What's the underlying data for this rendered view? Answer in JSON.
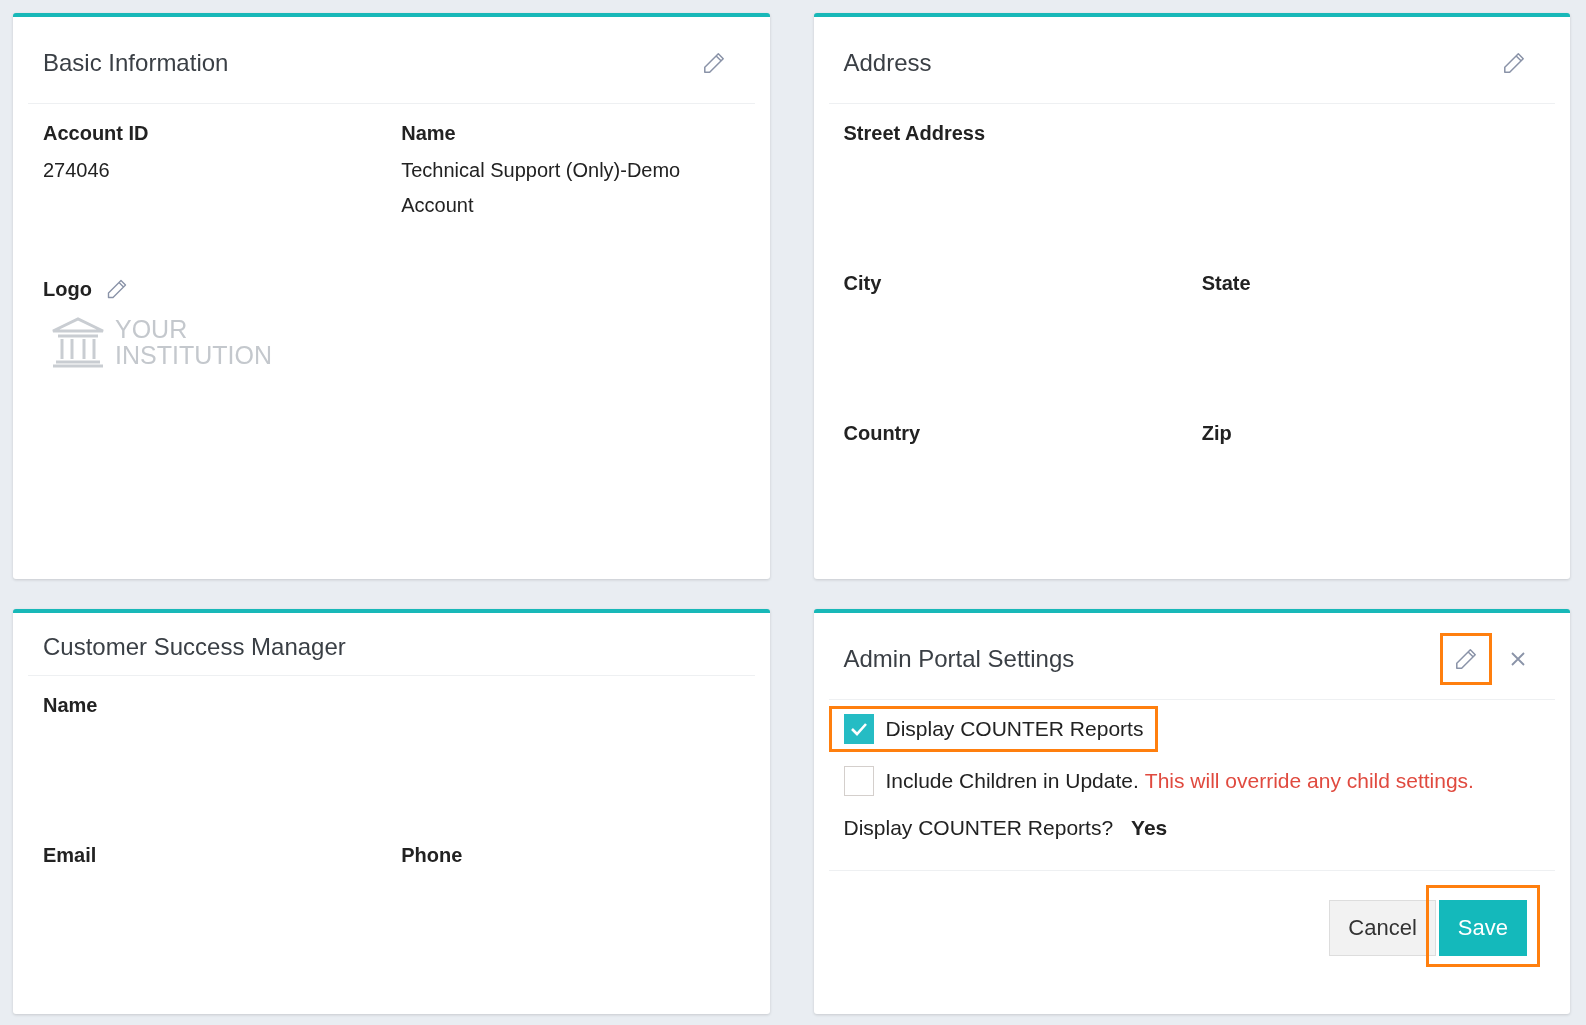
{
  "cards": [
    {
      "kind": "fields",
      "title": "Basic Information",
      "edit": {
        "highlighted": false
      },
      "fields": [
        {
          "kind": "text",
          "label": "Account ID",
          "value": "274046",
          "wide": false
        },
        {
          "kind": "text",
          "label": "Name",
          "value": "Technical Support (Only)-Demo Account",
          "wide": false
        },
        {
          "kind": "logo",
          "label": "Logo",
          "logo_text": [
            "YOUR",
            "INSTITUTION"
          ],
          "wide": true
        }
      ]
    },
    {
      "kind": "fields",
      "title": "Address",
      "edit": {
        "highlighted": false
      },
      "fields": [
        {
          "kind": "text",
          "label": "Street Address",
          "wide": true
        },
        {
          "kind": "text",
          "label": "City",
          "wide": false
        },
        {
          "kind": "text",
          "label": "State",
          "wide": false
        },
        {
          "kind": "text",
          "label": "Country",
          "wide": false
        },
        {
          "kind": "text",
          "label": "Zip",
          "wide": false
        }
      ]
    },
    {
      "kind": "fields",
      "title": "Customer Success Manager",
      "fields": [
        {
          "kind": "text",
          "label": "Name",
          "wide": true
        },
        {
          "kind": "text",
          "label": "Email",
          "wide": false
        },
        {
          "kind": "text",
          "label": "Phone",
          "wide": false
        }
      ]
    },
    {
      "kind": "settings",
      "title": "Admin Portal Settings",
      "edit": {
        "highlighted": true
      },
      "closable": true,
      "checkboxes": [
        {
          "label": "Display COUNTER Reports",
          "checked": true,
          "highlighted": true
        },
        {
          "label": "Include Children in Update.",
          "warning": "This will override any child settings.",
          "checked": false,
          "highlighted": false
        }
      ],
      "summary": {
        "label": "Display COUNTER Reports?",
        "value": "Yes"
      },
      "buttons": [
        {
          "kind": "secondary",
          "label": "Cancel",
          "highlighted": false
        },
        {
          "kind": "primary",
          "label": "Save",
          "highlighted": true
        }
      ]
    }
  ]
}
